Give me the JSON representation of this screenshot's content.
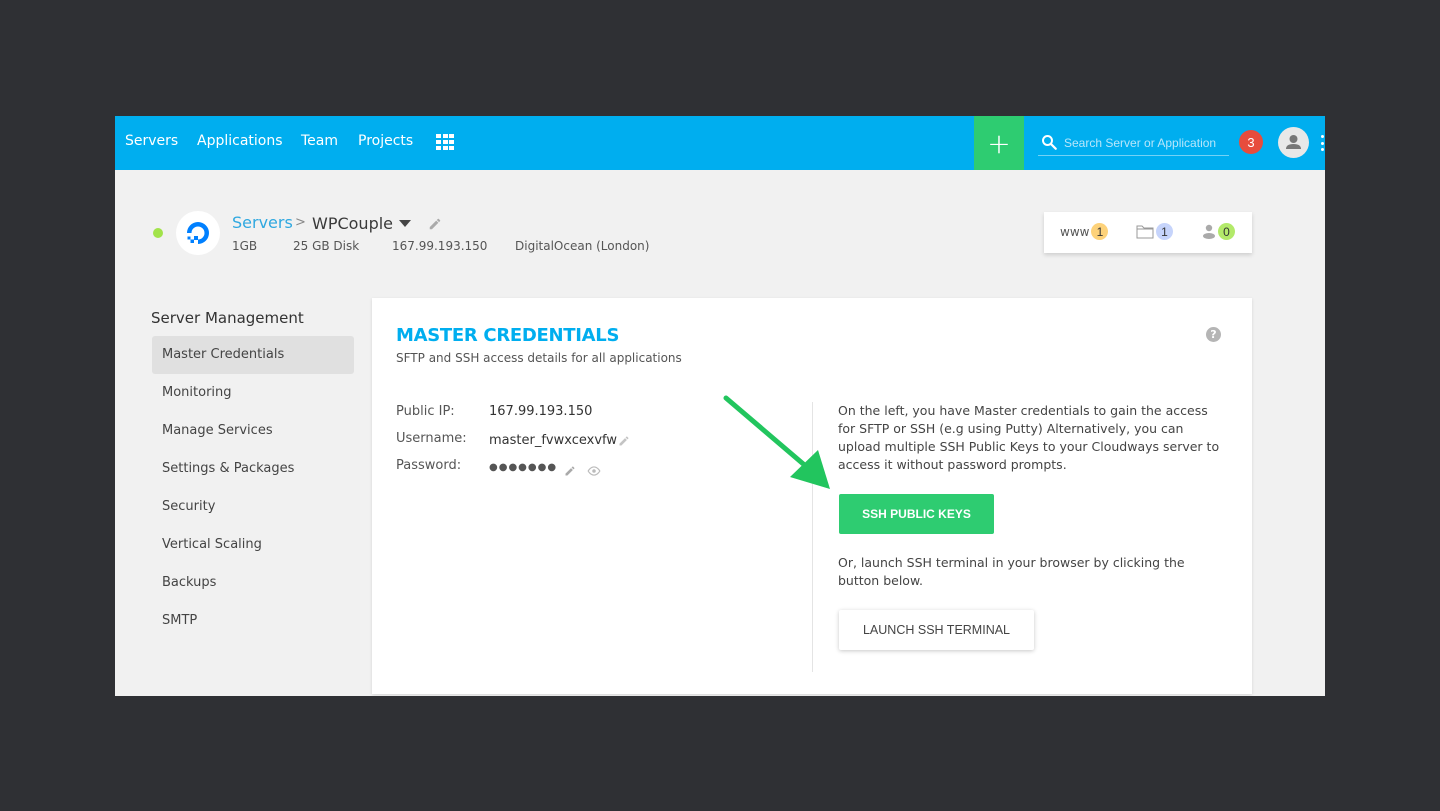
{
  "nav": {
    "items": [
      "Servers",
      "Applications",
      "Team",
      "Projects"
    ],
    "add_label": "+",
    "search_placeholder": "Search Server or Application",
    "notification_count": "3"
  },
  "server": {
    "breadcrumb_root": "Servers",
    "breadcrumb_sep": ">",
    "name": "WPCouple",
    "status": "online",
    "ram": "1GB",
    "disk": "25 GB Disk",
    "ip": "167.99.193.150",
    "provider": "DigitalOcean (London)",
    "stats": {
      "www_label": "www",
      "apps_count": "1",
      "folders_count": "1",
      "users_count": "0"
    }
  },
  "sidebar": {
    "title": "Server Management",
    "items": [
      {
        "label": "Master Credentials",
        "active": true
      },
      {
        "label": "Monitoring"
      },
      {
        "label": "Manage Services"
      },
      {
        "label": "Settings & Packages"
      },
      {
        "label": "Security"
      },
      {
        "label": "Vertical Scaling"
      },
      {
        "label": "Backups"
      },
      {
        "label": "SMTP"
      }
    ]
  },
  "main": {
    "title": "MASTER CREDENTIALS",
    "subtitle": "SFTP and SSH access details for all applications",
    "help": "?",
    "credentials": {
      "public_ip_label": "Public IP:",
      "public_ip": "167.99.193.150",
      "username_label": "Username:",
      "username": "master_fvwxcexvfw",
      "password_label": "Password:",
      "password": "●●●●●●●"
    },
    "info_text": "On the left, you have Master credentials to gain the access for SFTP or SSH (e.g using Putty) Alternatively, you can upload multiple SSH Public Keys to your Cloudways server to access it without password prompts.",
    "ssh_keys_button": "SSH PUBLIC KEYS",
    "terminal_text": "Or, launch SSH terminal in your browser by clicking the button below.",
    "terminal_button": "LAUNCH SSH TERMINAL"
  },
  "colors": {
    "brand": "#00aeef",
    "accent_green": "#2ecc71",
    "notification": "#e74c3c",
    "status_online": "#a2e34a",
    "badge_yellow": "#fdd27a",
    "badge_blue": "#c6d4fb",
    "badge_green": "#b3ea6a"
  }
}
